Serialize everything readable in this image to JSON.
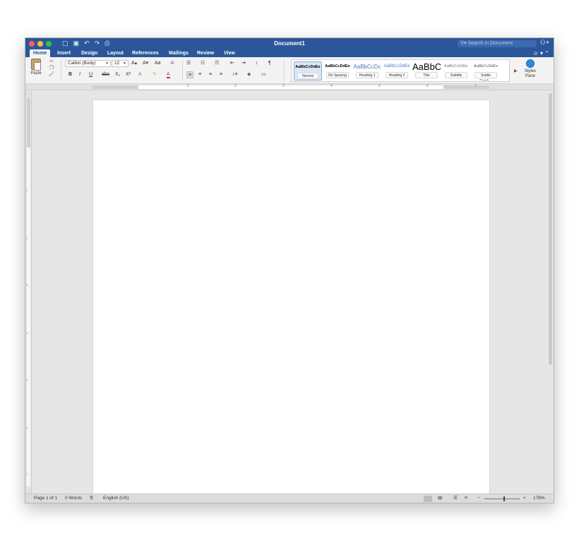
{
  "window": {
    "title": "Document1",
    "search_placeholder": "Search in Document",
    "quick_access": [
      "▢",
      "▣",
      "↶",
      "↷",
      "⎙"
    ],
    "share_glyph": "⚇+"
  },
  "tabs": [
    {
      "label": "Home",
      "active": true
    },
    {
      "label": "Insert"
    },
    {
      "label": "Design"
    },
    {
      "label": "Layout"
    },
    {
      "label": "References"
    },
    {
      "label": "Mailings"
    },
    {
      "label": "Review"
    },
    {
      "label": "View"
    }
  ],
  "tab_right": "☺ ▾ ⌃",
  "ribbon": {
    "paste_label": "Paste",
    "font_name": "Calibri (Body)",
    "font_size": "12",
    "bold": "B",
    "italic": "I",
    "underline": "U",
    "strike": "abc",
    "subscript": "X₂",
    "superscript": "X²",
    "grow": "A▴",
    "shrink": "A▾",
    "change_case": "Aa",
    "clear_format": "A̸",
    "text_effects": "A",
    "highlight": "✎",
    "font_color": "A",
    "bullets": "☰",
    "numbering": "☷",
    "multilevel": "☶",
    "decrease_indent": "⇤",
    "increase_indent": "⇥",
    "sort": "↕",
    "pilcrow": "¶",
    "align_left": "≡",
    "align_center": "≡",
    "align_right": "≡",
    "justify": "≡",
    "line_spacing": "↕≡",
    "shading": "◈",
    "borders": "▭",
    "styles_pane_label": "Styles Pane",
    "styles": [
      {
        "sample": "AaBbCcDdEe",
        "name": "Normal"
      },
      {
        "sample": "AaBbCcDdEe",
        "name": "No Spacing"
      },
      {
        "sample": "AaBbCcDc",
        "name": "Heading 1"
      },
      {
        "sample": "AaBbCcDdEe",
        "name": "Heading 2"
      },
      {
        "sample": "AaBbC",
        "name": "Title"
      },
      {
        "sample": "AaBbCcDdEe",
        "name": "Subtitle"
      },
      {
        "sample": "AaBbCcDdEe",
        "name": "Subtle Emph..."
      }
    ]
  },
  "ruler": {
    "numbers": [
      "1",
      "2",
      "3",
      "4",
      "5",
      "6",
      "7"
    ],
    "vnumbers": [
      "1",
      "2",
      "3",
      "4",
      "5",
      "6",
      "7",
      "8"
    ]
  },
  "status": {
    "page": "Page 1 of 1",
    "words": "0 Words",
    "language": "English (US)",
    "zoom": "178%"
  },
  "colors": {
    "accent": "#2b579a",
    "light_red": "#ff5f57",
    "light_yellow": "#febc2e",
    "light_green": "#28c840"
  }
}
